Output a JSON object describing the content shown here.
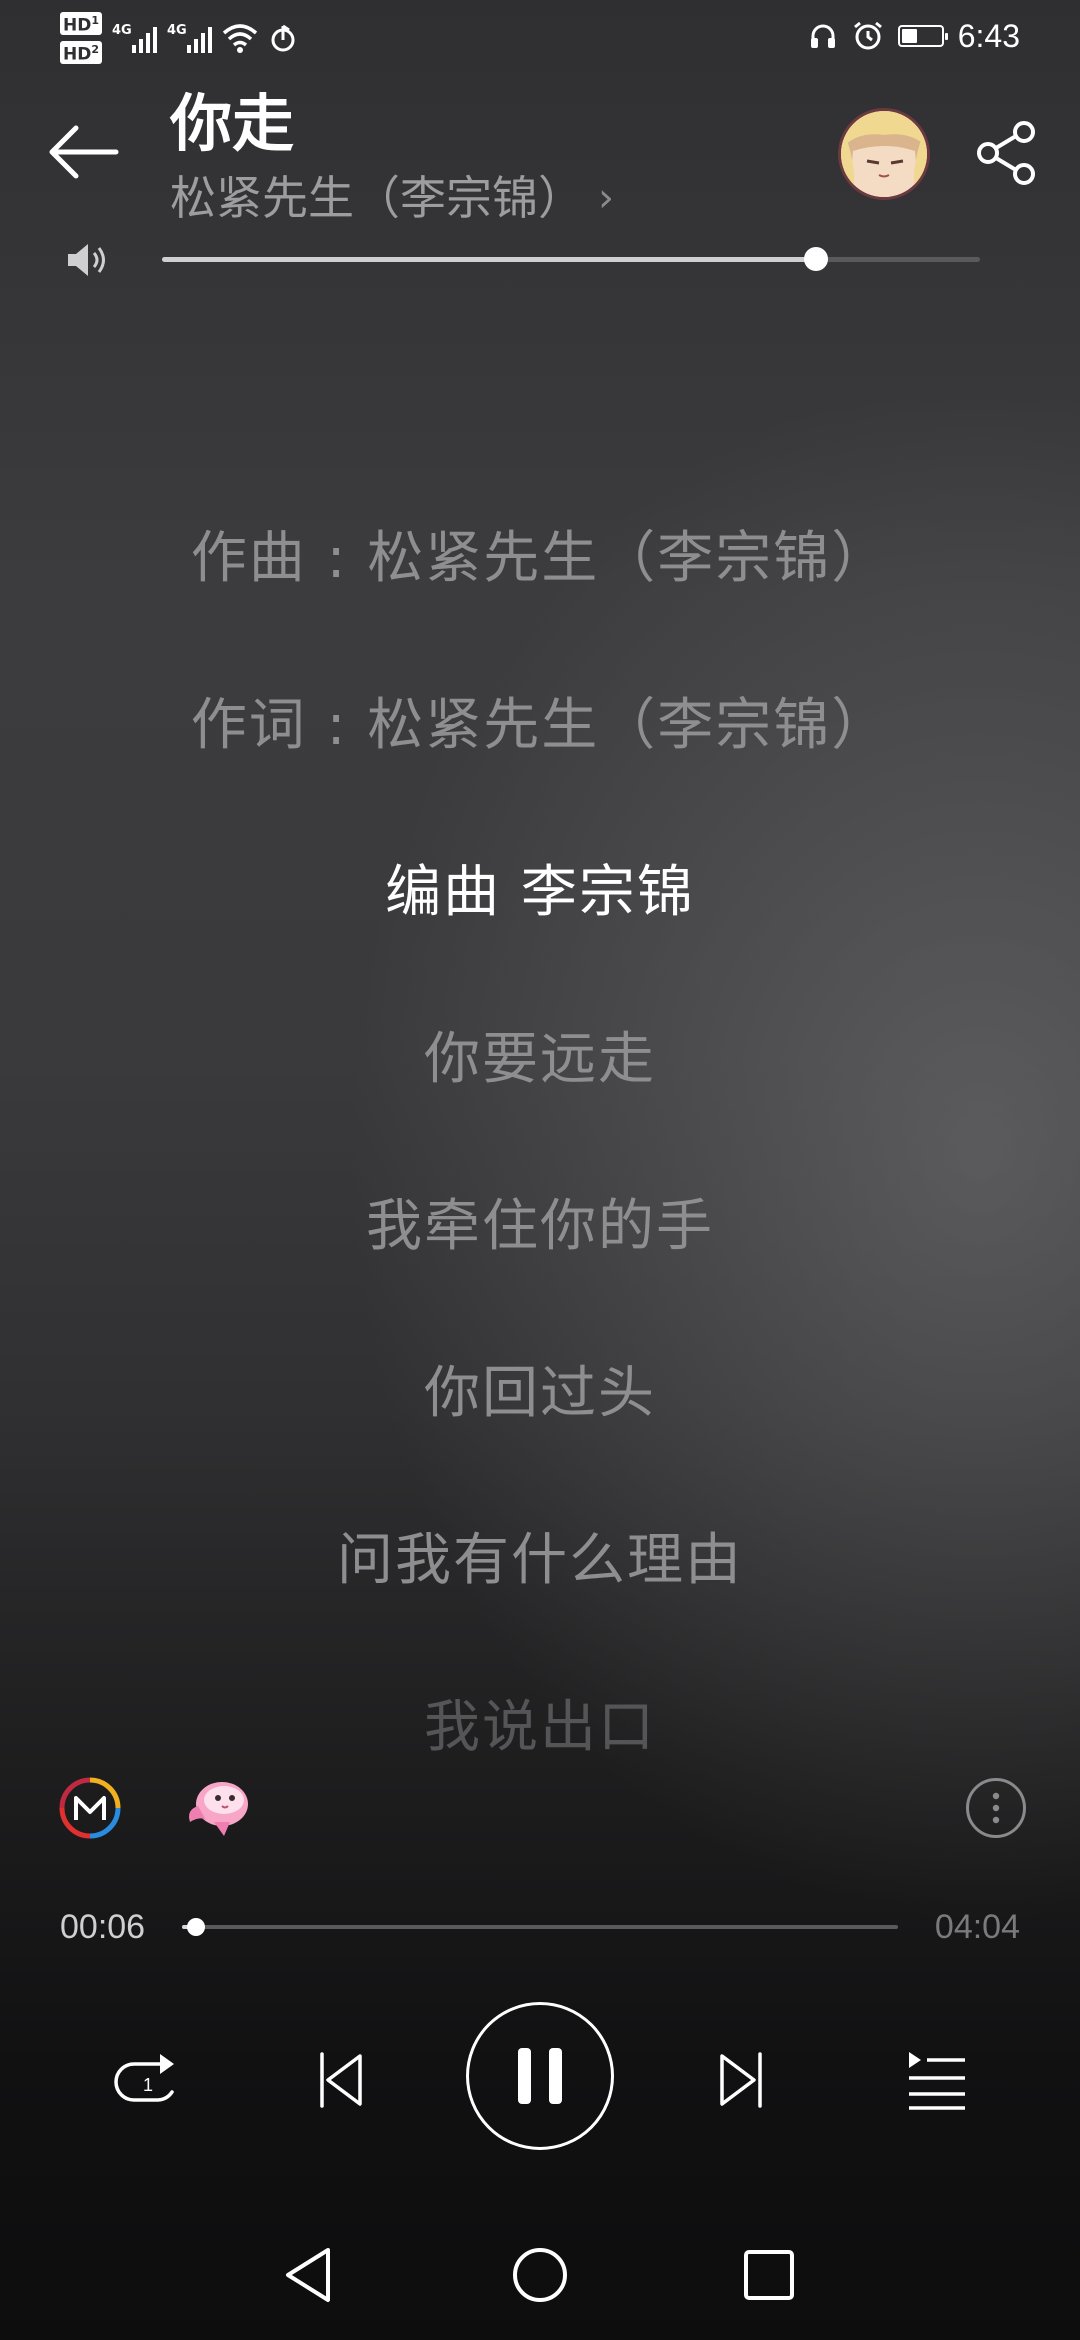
{
  "status_bar": {
    "hd1": "HD",
    "hd1_sub": "1",
    "hd2": "HD",
    "hd2_sub": "2",
    "net1": "4G",
    "net2": "4G",
    "battery_level": 0.4,
    "time": "6:43",
    "icons": [
      "hd-icon",
      "signal-icon",
      "wifi-icon",
      "nfc-icon",
      "headphones-icon",
      "alarm-icon",
      "battery-icon"
    ]
  },
  "header": {
    "title": "你走",
    "artist": "松紧先生（李宗锦）",
    "artist_chevron": "›"
  },
  "volume": {
    "level": 0.8
  },
  "lyrics": [
    {
      "text": "作曲 : 松紧先生（李宗锦）",
      "state": "normal"
    },
    {
      "text": "作词 : 松紧先生（李宗锦）",
      "state": "normal"
    },
    {
      "text": "编曲 李宗锦",
      "state": "active"
    },
    {
      "text": "你要远走",
      "state": "normal"
    },
    {
      "text": "我牵住你的手",
      "state": "normal"
    },
    {
      "text": "你回过头",
      "state": "normal"
    },
    {
      "text": "问我有什么理由",
      "state": "normal"
    },
    {
      "text": "我说出口",
      "state": "faded"
    }
  ],
  "playback": {
    "current_time": "00:06",
    "total_time": "04:04",
    "progress": 0.02,
    "repeat_mode_badge": "1"
  },
  "colors": {
    "accent": "#ffffff",
    "lyric_dim": "#8e8e90",
    "artist": "#9d9d9f"
  }
}
